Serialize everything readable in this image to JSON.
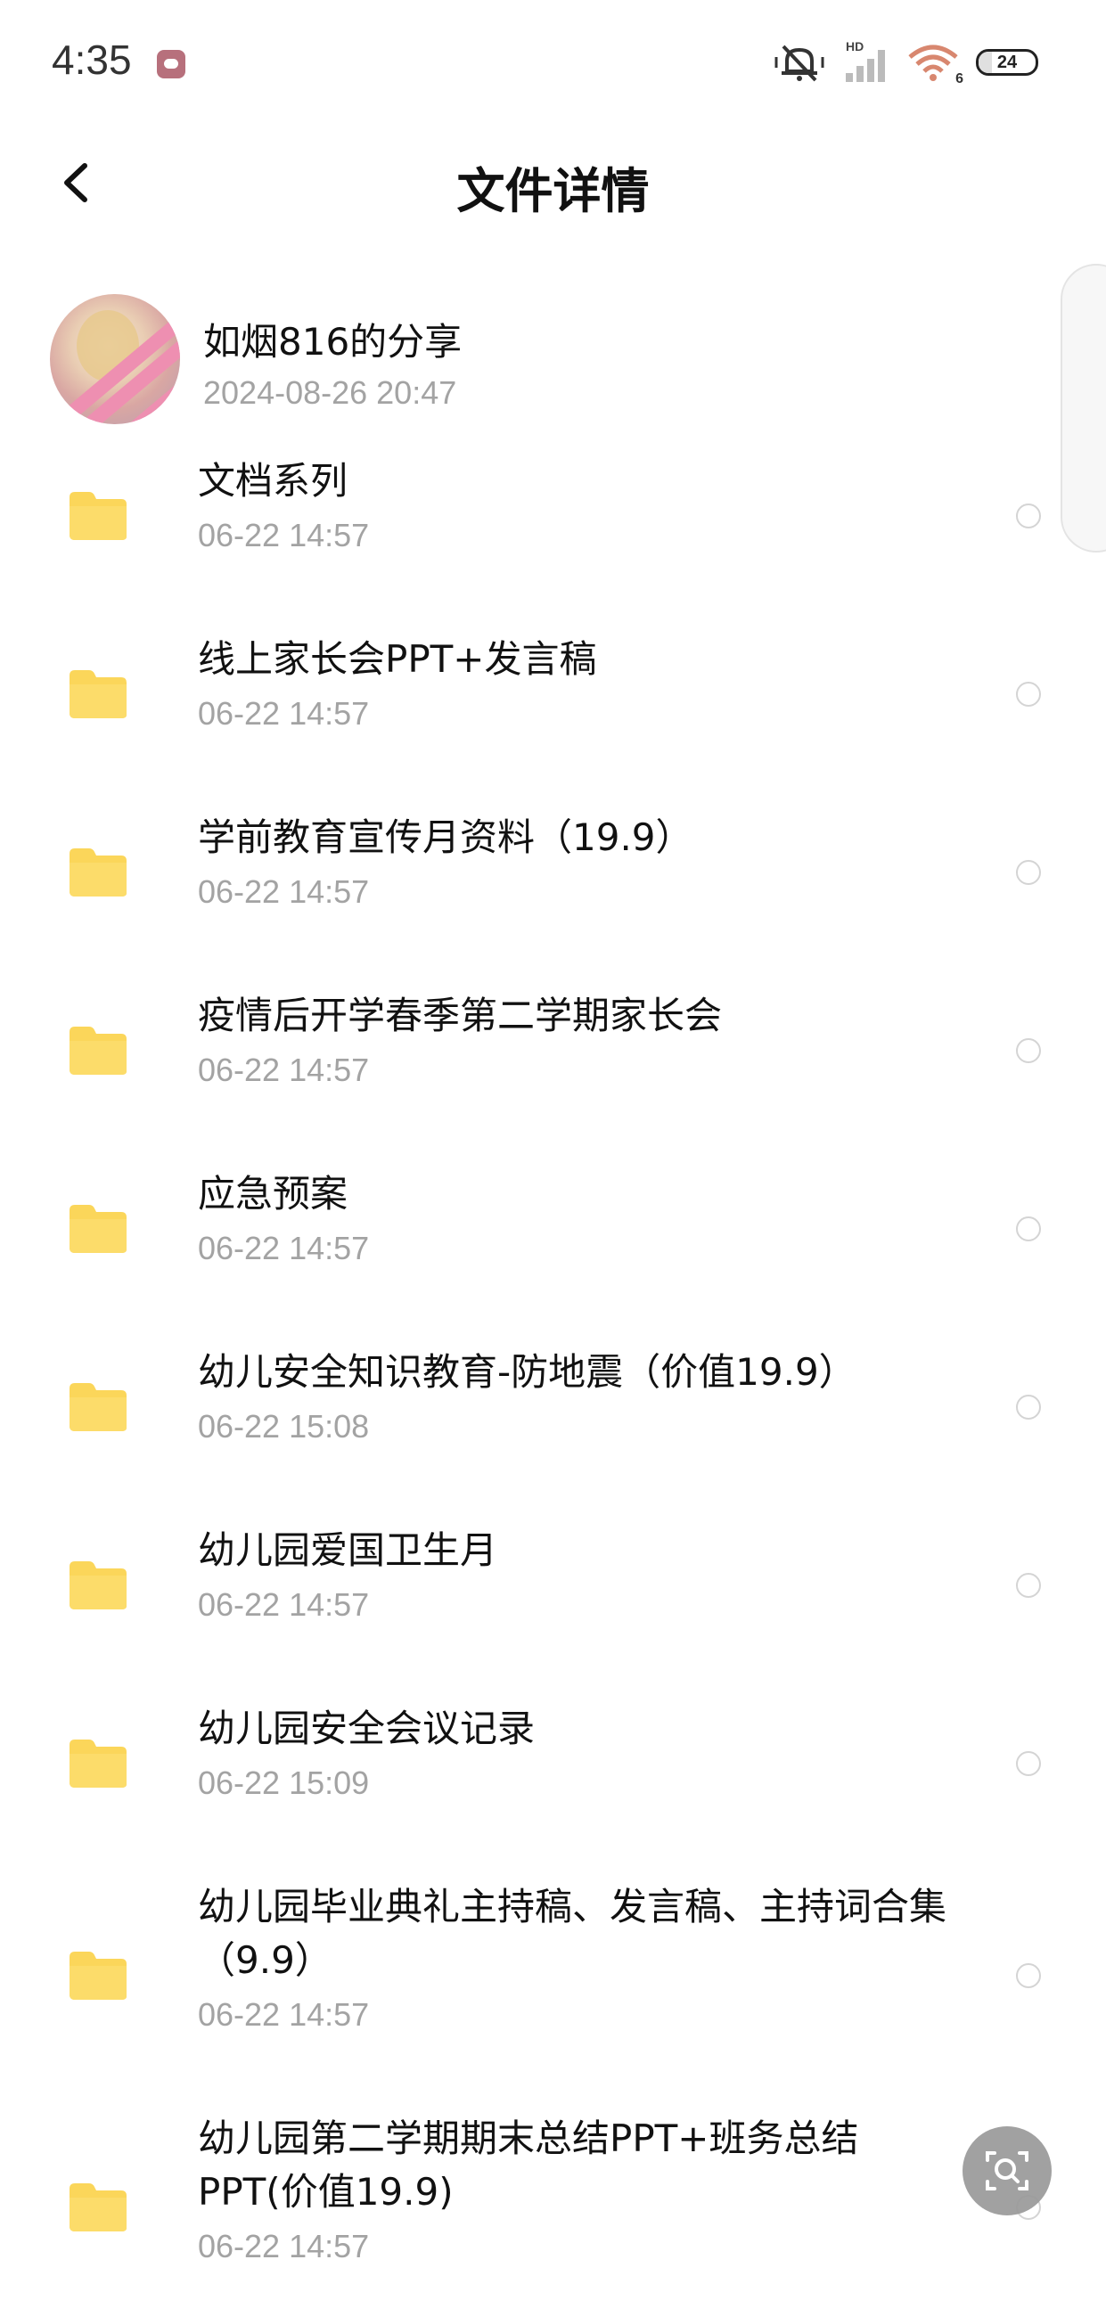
{
  "status_bar": {
    "time": "4:35",
    "network_label": "HD",
    "wifi_label": "6",
    "battery_level": "24",
    "battery_fraction": 0.24,
    "icons": [
      "mute-icon",
      "signal-icon",
      "wifi-icon",
      "battery-icon"
    ]
  },
  "header": {
    "back_icon": "chevron-left-icon",
    "title": "文件详情"
  },
  "share": {
    "name": "如烟816的分享",
    "time": "2024-08-26  20:47"
  },
  "files": [
    {
      "name": "文档系列",
      "date": "06-22  14:57"
    },
    {
      "name": "线上家长会PPT+发言稿",
      "date": "06-22  14:57"
    },
    {
      "name": "学前教育宣传月资料（19.9）",
      "date": "06-22  14:57"
    },
    {
      "name": "疫情后开学春季第二学期家长会",
      "date": "06-22  14:57"
    },
    {
      "name": "应急预案",
      "date": "06-22  14:57"
    },
    {
      "name": "幼儿安全知识教育-防地震（价值19.9）",
      "date": "06-22  15:08"
    },
    {
      "name": "幼儿园爱国卫生月",
      "date": "06-22  14:57"
    },
    {
      "name": "幼儿园安全会议记录",
      "date": "06-22  15:09"
    },
    {
      "name": "幼儿园毕业典礼主持稿、发言稿、主持词合集（9.9）",
      "date": "06-22  14:57"
    },
    {
      "name": "幼儿园第二学期期末总结PPT+班务总结PPT(价值19.9)",
      "date": "06-22  14:57"
    }
  ],
  "colors": {
    "folder": "#fbd65a",
    "secondary_text": "#a3a3a3",
    "float_button": "#9a9a9a"
  }
}
